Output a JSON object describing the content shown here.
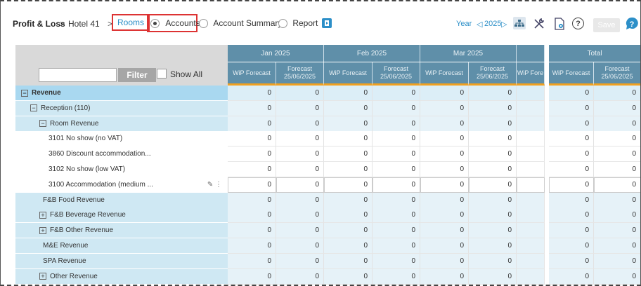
{
  "breadcrumb": {
    "app": "Profit & Loss",
    "sep1": ">",
    "hotel": "Hotel 41",
    "sep2": ">",
    "rooms": "Rooms"
  },
  "view_options": [
    {
      "label": "Accounts",
      "selected": true
    },
    {
      "label": "Account Summary",
      "selected": false
    },
    {
      "label": "Report",
      "selected": false
    }
  ],
  "period": {
    "label": "Year",
    "prev": "◁",
    "year": "2025",
    "next": "▷"
  },
  "toolbar": {
    "save_label": "Save",
    "help_glyph": "?"
  },
  "filter": {
    "button": "Filter",
    "show_all": "Show All",
    "value": ""
  },
  "colors": {
    "header": "#5f8fa9",
    "accent": "#f0a020",
    "brand": "#2c8fc8",
    "revenue_row": "#a9d8f0",
    "group_row": "#cfe8f3",
    "highlight": "#d33"
  },
  "months": [
    {
      "name": "Jan 2025",
      "cols": [
        "WiP Forecast",
        "Forecast 25/06/2025"
      ]
    },
    {
      "name": "Feb 2025",
      "cols": [
        "WiP Forecast",
        "Forecast 25/06/2025"
      ]
    },
    {
      "name": "Mar 2025",
      "cols": [
        "WiP Forecast",
        "Forecast 25/06/2025"
      ]
    },
    {
      "name": "",
      "cols": [
        "WiP Fore"
      ]
    },
    {
      "name": "Total",
      "cols": [
        "WiP Forecast",
        "Forecast 25/06/2025"
      ]
    }
  ],
  "rows": [
    {
      "label": "Revenue",
      "level": 0,
      "toggle": "−",
      "style": "revenue",
      "values": [
        "0",
        "0",
        "0",
        "0",
        "0",
        "0",
        "",
        "0",
        "0"
      ]
    },
    {
      "label": "Reception (110)",
      "level": 1,
      "toggle": "−",
      "style": "group",
      "values": [
        "0",
        "0",
        "0",
        "0",
        "0",
        "0",
        "",
        "0",
        "0"
      ]
    },
    {
      "label": "Room Revenue",
      "level": 2,
      "toggle": "−",
      "style": "group",
      "values": [
        "0",
        "0",
        "0",
        "0",
        "0",
        "0",
        "",
        "0",
        "0"
      ]
    },
    {
      "label": "3101 No show (no VAT)",
      "level": 3,
      "toggle": "",
      "style": "leaf",
      "values": [
        "0",
        "0",
        "0",
        "0",
        "0",
        "0",
        "",
        "0",
        "0"
      ]
    },
    {
      "label": "3860 Discount accommodation...",
      "level": 3,
      "toggle": "",
      "style": "leaf",
      "values": [
        "0",
        "0",
        "0",
        "0",
        "0",
        "0",
        "",
        "0",
        "0"
      ]
    },
    {
      "label": "3102 No show (low VAT)",
      "level": 3,
      "toggle": "",
      "style": "leaf",
      "values": [
        "0",
        "0",
        "0",
        "0",
        "0",
        "0",
        "",
        "0",
        "0"
      ]
    },
    {
      "label": "3100 Accommodation (medium ...",
      "level": 3,
      "toggle": "",
      "style": "leaf",
      "edit": true,
      "values": [
        "0",
        "0",
        "0",
        "0",
        "0",
        "0",
        "",
        "0",
        "0"
      ]
    },
    {
      "label": "F&B Food Revenue",
      "level": 2,
      "toggle": "",
      "style": "group",
      "values": [
        "0",
        "0",
        "0",
        "0",
        "0",
        "0",
        "",
        "0",
        "0"
      ]
    },
    {
      "label": "F&B Beverage Revenue",
      "level": 2,
      "toggle": "+",
      "style": "group",
      "values": [
        "0",
        "0",
        "0",
        "0",
        "0",
        "0",
        "",
        "0",
        "0"
      ]
    },
    {
      "label": "F&B Other Revenue",
      "level": 2,
      "toggle": "+",
      "style": "group",
      "values": [
        "0",
        "0",
        "0",
        "0",
        "0",
        "0",
        "",
        "0",
        "0"
      ]
    },
    {
      "label": "M&E Revenue",
      "level": 2,
      "toggle": "",
      "style": "group",
      "values": [
        "0",
        "0",
        "0",
        "0",
        "0",
        "0",
        "",
        "0",
        "0"
      ]
    },
    {
      "label": "SPA Revenue",
      "level": 2,
      "toggle": "",
      "style": "group",
      "values": [
        "0",
        "0",
        "0",
        "0",
        "0",
        "0",
        "",
        "0",
        "0"
      ]
    },
    {
      "label": "Other Revenue",
      "level": 2,
      "toggle": "+",
      "style": "group",
      "values": [
        "0",
        "0",
        "0",
        "0",
        "0",
        "0",
        "",
        "0",
        "0"
      ]
    }
  ]
}
